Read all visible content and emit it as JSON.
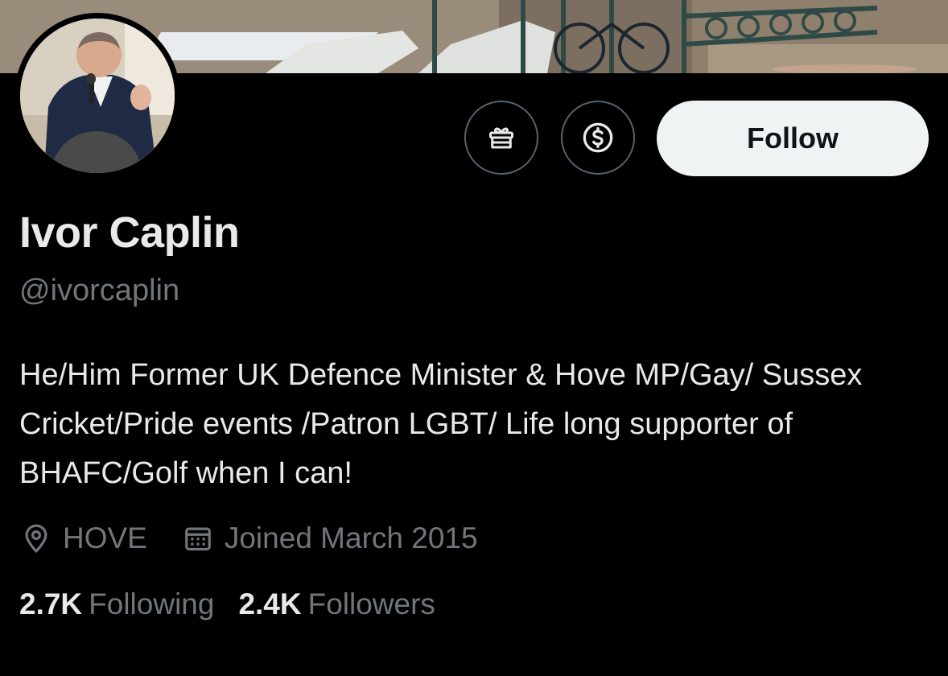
{
  "profile": {
    "name": "Ivor Caplin",
    "handle": "@ivorcaplin",
    "bio": "He/Him Former UK Defence Minister & Hove MP/Gay/ Sussex Cricket/Pride events /Patron LGBT/ Life long supporter of BHAFC/Golf when I can!",
    "location": "HOVE",
    "joined": "Joined March 2015"
  },
  "actions": {
    "follow_label": "Follow",
    "gift_icon": "gift-icon",
    "tip_icon": "dollar-circle-icon"
  },
  "stats": {
    "following_count": "2.7K",
    "following_label": "Following",
    "followers_count": "2.4K",
    "followers_label": "Followers"
  },
  "colors": {
    "background": "#000000",
    "primary_text": "#e7e9ea",
    "secondary_text": "#71767b",
    "button_border": "#536471",
    "follow_button_bg": "#eff3f4"
  }
}
